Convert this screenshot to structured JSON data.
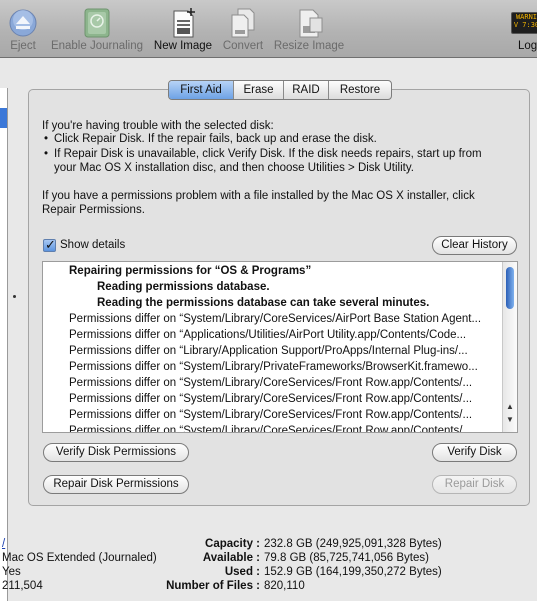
{
  "toolbar": {
    "eject_label": "Eject",
    "enable_journaling_label": "Enable Journaling",
    "new_image_label": "New Image",
    "convert_label": "Convert",
    "resize_image_label": "Resize Image",
    "log_label": "Log",
    "log_icon_text": "WARNI"
  },
  "tabs": [
    {
      "label": "First Aid",
      "selected": true
    },
    {
      "label": "Erase",
      "selected": false
    },
    {
      "label": "RAID",
      "selected": false
    },
    {
      "label": "Restore",
      "selected": false
    }
  ],
  "instructions": {
    "intro": "If you're having trouble with the selected disk:",
    "bullet1": "Click Repair Disk. If the repair fails, back up and erase the disk.",
    "bullet2_line1": "If Repair Disk is unavailable, click Verify Disk. If the disk needs repairs, start up from",
    "bullet2_line2": "your Mac OS X installation disc, and then choose Utilities > Disk Utility.",
    "permissions_line1": "If you have a permissions problem with a file installed by the Mac OS X installer, click",
    "permissions_line2": "Repair Permissions."
  },
  "show_details": {
    "label": "Show details",
    "checked": true
  },
  "buttons": {
    "clear_history": "Clear History",
    "verify_permissions": "Verify Disk Permissions",
    "repair_permissions": "Repair Disk Permissions",
    "verify_disk": "Verify Disk",
    "repair_disk": "Repair Disk"
  },
  "log": {
    "header": "Repairing permissions for “OS & Programs”",
    "sub1": "Reading permissions database.",
    "sub2": "Reading the permissions database can take several minutes.",
    "lines": [
      "Permissions differ on “System/Library/CoreServices/AirPort Base Station Agent...",
      "Permissions differ on “Applications/Utilities/AirPort Utility.app/Contents/Code...",
      "Permissions differ on “Library/Application Support/ProApps/Internal Plug-ins/...",
      "Permissions differ on “System/Library/PrivateFrameworks/BrowserKit.framewo...",
      "Permissions differ on “System/Library/CoreServices/Front Row.app/Contents/...",
      "Permissions differ on “System/Library/CoreServices/Front Row.app/Contents/...",
      "Permissions differ on “System/Library/CoreServices/Front Row.app/Contents/...",
      "Permissions differ on “System/Library/CoreServices/Front Row.app/Contents/..."
    ]
  },
  "info": {
    "mount_point": "/",
    "format": "Mac OS Extended (Journaled)",
    "owners_enabled": "Yes",
    "folder_count": "211,504",
    "capacity_label": "Capacity :",
    "capacity_value": "232.8 GB (249,925,091,328 Bytes)",
    "available_label": "Available :",
    "available_value": "79.8 GB (85,725,741,056 Bytes)",
    "used_label": "Used :",
    "used_value": "152.9 GB (164,199,350,272 Bytes)",
    "files_label": "Number of Files :",
    "files_value": "820,110"
  },
  "colors": {
    "accent": "#3b78d8",
    "selected_tab": "#6ea2e6",
    "panel_bg": "#e2e2e2",
    "toolbar_bg": "#b3b3b3"
  }
}
